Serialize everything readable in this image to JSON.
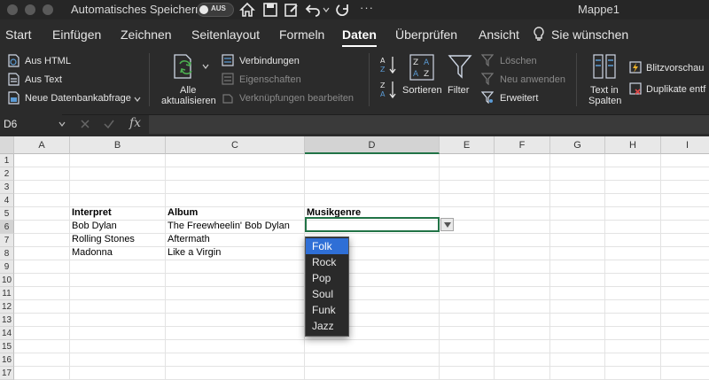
{
  "titlebar": {
    "autosave_label": "Automatisches Speichern",
    "toggle_label": "AUS",
    "doc_title": "Mappe1"
  },
  "tabs": [
    {
      "label": "Start"
    },
    {
      "label": "Einfügen"
    },
    {
      "label": "Zeichnen"
    },
    {
      "label": "Seitenlayout"
    },
    {
      "label": "Formeln"
    },
    {
      "label": "Daten",
      "active": true
    },
    {
      "label": "Überprüfen"
    },
    {
      "label": "Ansicht"
    },
    {
      "label": "Sie wünschen"
    }
  ],
  "ribbon": {
    "aus_html": "Aus HTML",
    "aus_text": "Aus Text",
    "neue_abfrage": "Neue Datenbankabfrage",
    "alle_1": "Alle",
    "alle_2": "aktualisieren",
    "verbindungen": "Verbindungen",
    "eigenschaften": "Eigenschaften",
    "verknuepfungen": "Verknüpfungen bearbeiten",
    "sortieren": "Sortieren",
    "filter": "Filter",
    "loeschen": "Löschen",
    "neu_anwenden": "Neu anwenden",
    "erweitert": "Erweitert",
    "text_in_1": "Text in",
    "text_in_2": "Spalten",
    "blitzvorschau": "Blitzvorschau",
    "duplikate": "Duplikate entf"
  },
  "formula_bar": {
    "name_box": "D6",
    "fx": "fx",
    "content": ""
  },
  "grid": {
    "columns": [
      "A",
      "B",
      "C",
      "D",
      "E",
      "F",
      "G",
      "H",
      "I"
    ],
    "selected_column": "D",
    "rows": [
      "1",
      "2",
      "3",
      "4",
      "5",
      "6",
      "7",
      "8",
      "9",
      "10",
      "11",
      "12",
      "13",
      "14",
      "15",
      "16",
      "17"
    ],
    "selected_row": "6",
    "cells": {
      "B5": "Interpret",
      "C5": "Album",
      "D5": "Musikgenre",
      "B6": "Bob Dylan",
      "C6": "The Freewheelin' Bob Dylan",
      "B7": "Rolling Stones",
      "C7": "Aftermath",
      "B8": "Madonna",
      "C8": "Like a Virgin"
    }
  },
  "dropdown": {
    "options": [
      "Folk",
      "Rock",
      "Pop",
      "Soul",
      "Funk",
      "Jazz"
    ],
    "highlighted": "Folk"
  },
  "colors": {
    "accent_green": "#217346",
    "highlight_blue": "#2f6fd6"
  }
}
